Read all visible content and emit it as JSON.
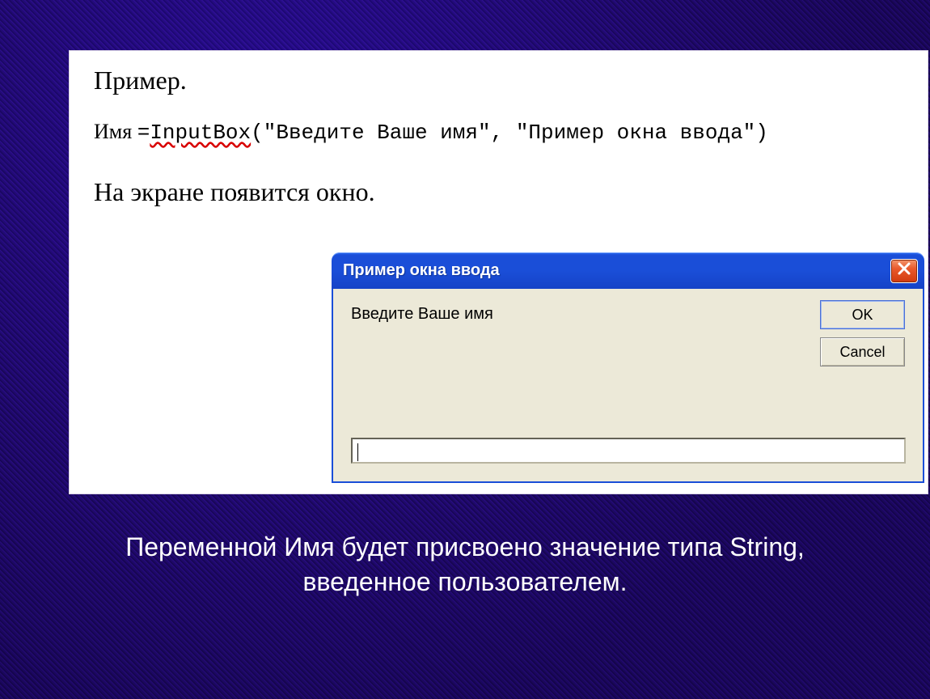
{
  "doc": {
    "heading": "Пример.",
    "code": {
      "var": "Имя ",
      "eq": "=",
      "fn": "InputBox",
      "open": "(",
      "arg1": "\"Введите Ваше имя\"",
      "comma": ", ",
      "arg2": "\"Пример окна ввода\"",
      "close": ")"
    },
    "result": "На экране появится окно."
  },
  "dialog": {
    "title": "Пример окна ввода",
    "prompt": "Введите Ваше имя",
    "ok": "OK",
    "cancel": "Cancel",
    "input_value": ""
  },
  "caption": "Переменной Имя будет присвоено значение типа String, введенное пользователем."
}
